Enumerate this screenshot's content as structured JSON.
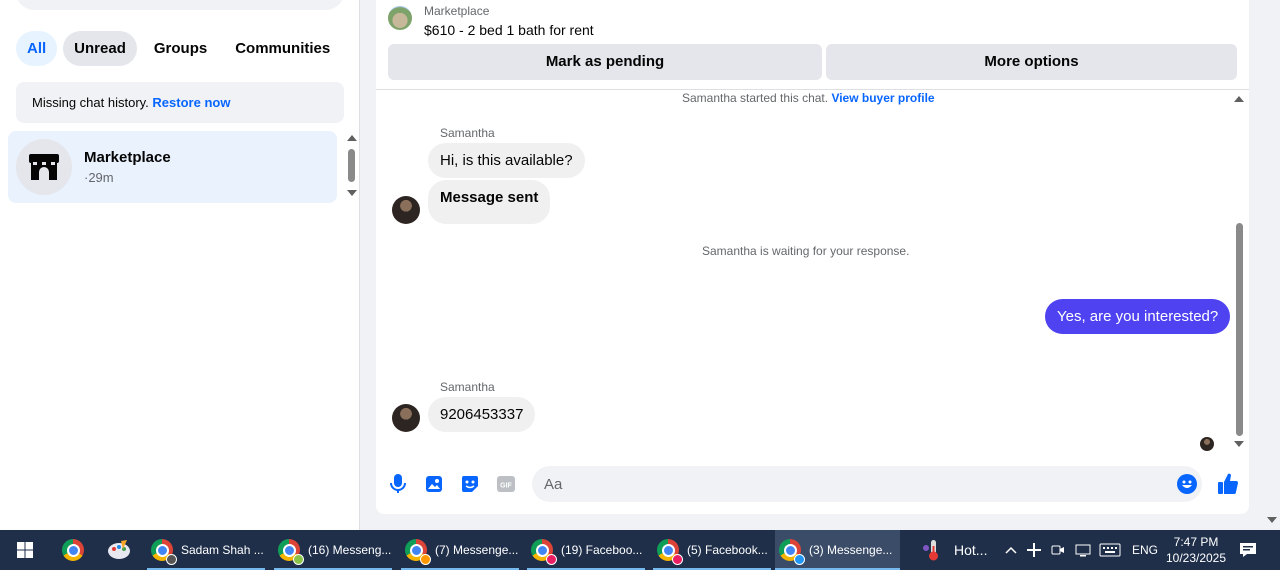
{
  "filters": {
    "all": "All",
    "unread": "Unread",
    "groups": "Groups",
    "communities": "Communities"
  },
  "notice": {
    "text": "Missing chat history.",
    "link": "Restore now"
  },
  "chat_list": [
    {
      "name": "Marketplace",
      "time": "·29m"
    }
  ],
  "listing": {
    "source": "Marketplace",
    "title": "$610 - 2 bed 1 bath for rent"
  },
  "actions": {
    "pending": "Mark as pending",
    "more": "More options"
  },
  "system": {
    "started": "Samantha started this chat.",
    "buyer_link": "View buyer profile",
    "waiting": "Samantha is waiting for your response."
  },
  "messages": {
    "sender1": "Samantha",
    "m1": "Hi, is this available?",
    "m2": "Message sent",
    "out1": "Yes, are you interested?",
    "sender2": "Samantha",
    "m3": "9206453337"
  },
  "composer": {
    "placeholder": "Aa"
  },
  "taskbar": {
    "windows": [
      "Sadam Shah ...",
      "(16) Messeng...",
      "(7) Messenge...",
      "(19) Faceboo...",
      "(5) Facebook...",
      "(3) Messenge..."
    ],
    "weather": "Hot...",
    "lang": "ENG",
    "time": "7:47 PM",
    "date": "10/23/2025"
  },
  "colors": {
    "accent": "#0866ff",
    "outgoing_bubble": "#4f42f1",
    "taskbar": "#1f2f4a"
  }
}
